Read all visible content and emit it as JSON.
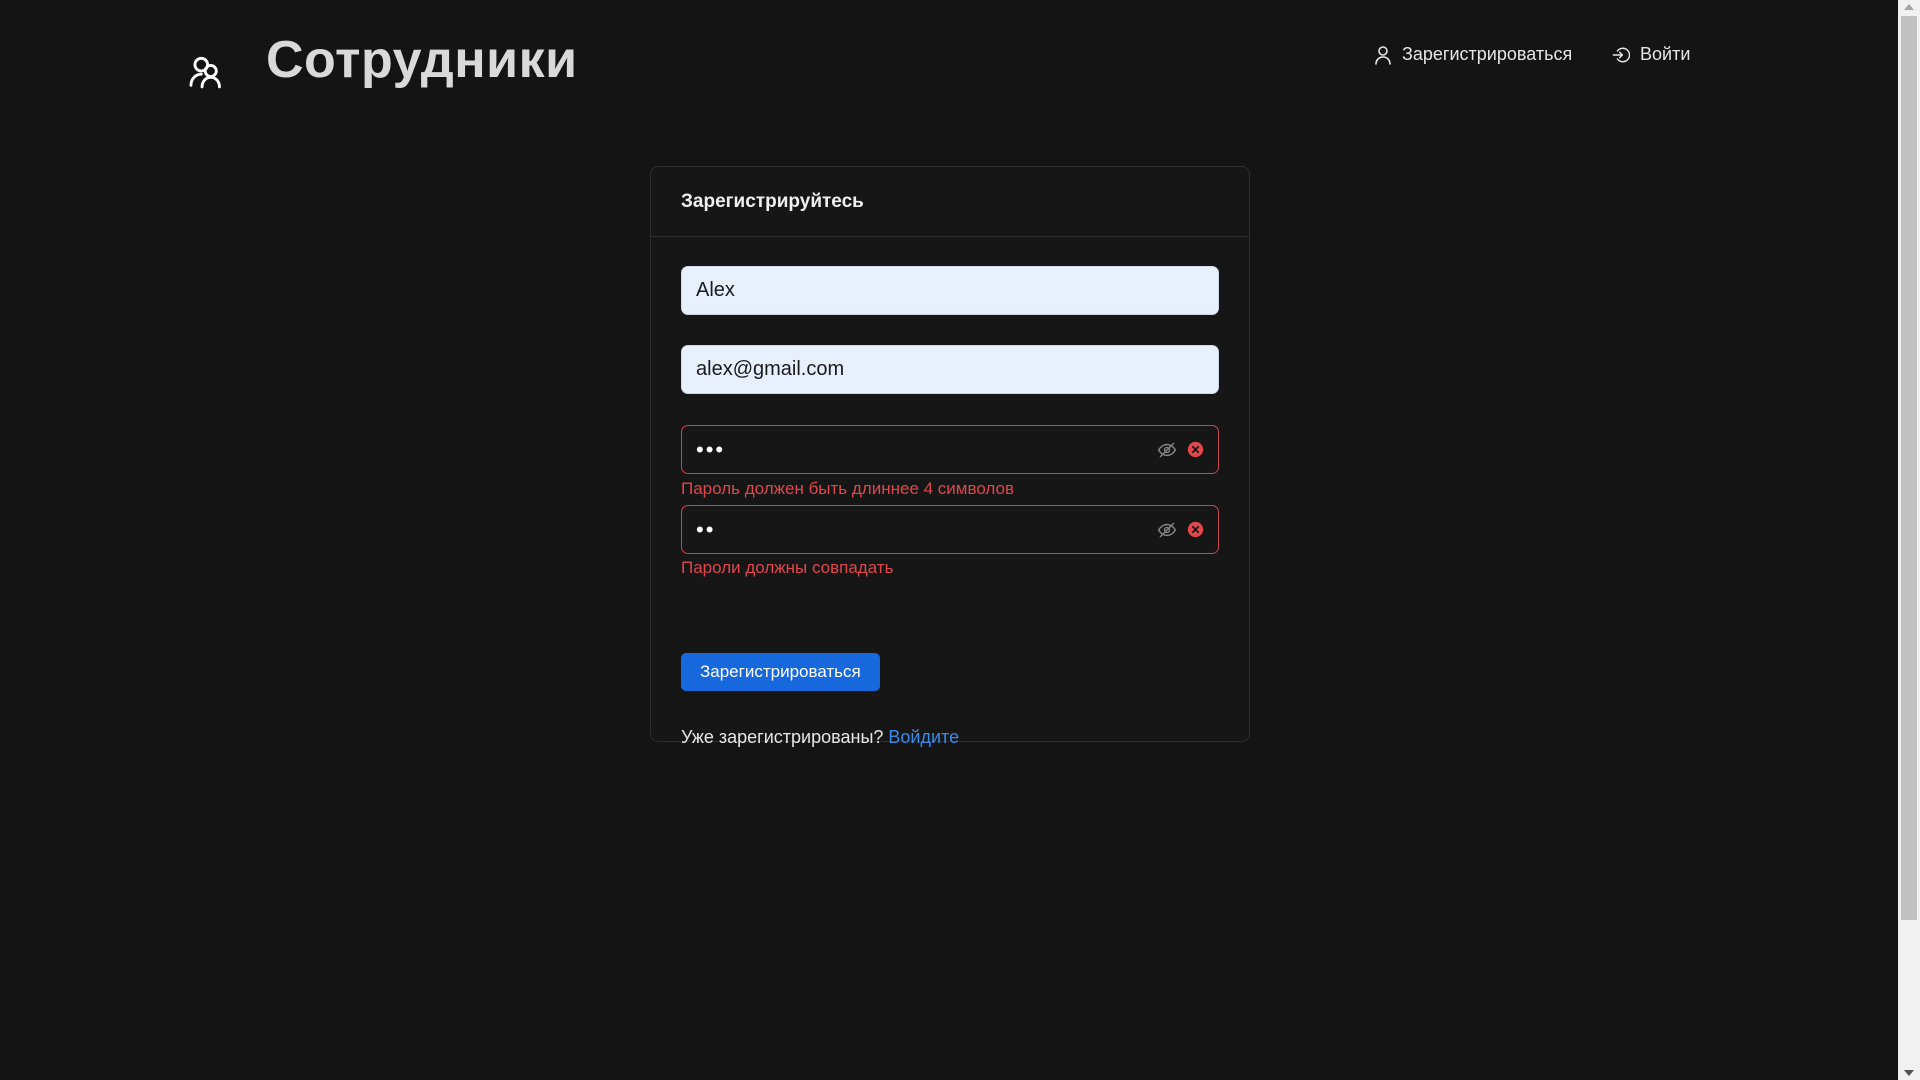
{
  "header": {
    "logo_icon": "team-icon",
    "title": "Сотрудники",
    "nav": {
      "register_icon": "user-icon",
      "register_label": "Зарегистрироваться",
      "login_icon": "login-icon",
      "login_label": "Войти"
    }
  },
  "form": {
    "heading": "Зарегистрируйтесь",
    "name_value": "Alex",
    "email_value": "alex@gmail.com",
    "password_value": "•••",
    "password_error": "Пароль должен быть длиннее 4 символов",
    "confirm_value": "••",
    "confirm_error": "Пароли должны совпадать",
    "submit_label": "Зарегистрироваться",
    "already_text": "Уже зарегистрированы?",
    "login_link": "Войдите"
  },
  "colors": {
    "background": "#141414",
    "accent": "#1668dc",
    "link": "#3c89e8",
    "error": "#e0474c"
  }
}
